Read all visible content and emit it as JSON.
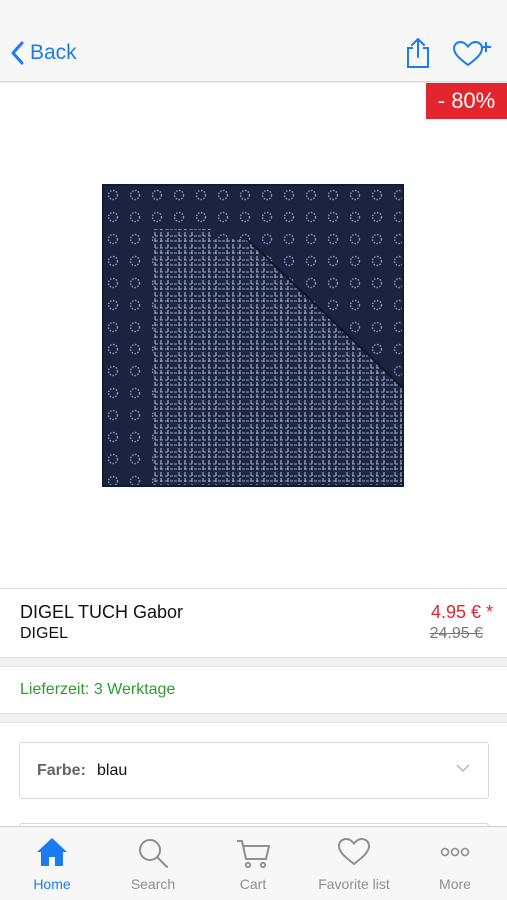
{
  "nav": {
    "back_label": "Back",
    "share_icon": "share-icon",
    "favorite_add_icon": "heart-plus-icon"
  },
  "product": {
    "discount": "- 80%",
    "name": "DIGEL TUCH Gabor",
    "brand": "DIGEL",
    "price": "4.95 € *",
    "old_price": "24.95 €",
    "delivery": "Lieferzeit: 3 Werktage"
  },
  "options": {
    "color_label": "Farbe:",
    "color_value": "blau"
  },
  "tabbar": {
    "items": [
      {
        "label": "Home",
        "icon": "home-icon"
      },
      {
        "label": "Search",
        "icon": "search-icon"
      },
      {
        "label": "Cart",
        "icon": "cart-icon"
      },
      {
        "label": "Favorite list",
        "icon": "heart-icon"
      },
      {
        "label": "More",
        "icon": "more-icon"
      }
    ]
  },
  "colors": {
    "accent": "#1a7cf0",
    "sale": "#e3262e",
    "delivery": "#2f9a2f"
  }
}
